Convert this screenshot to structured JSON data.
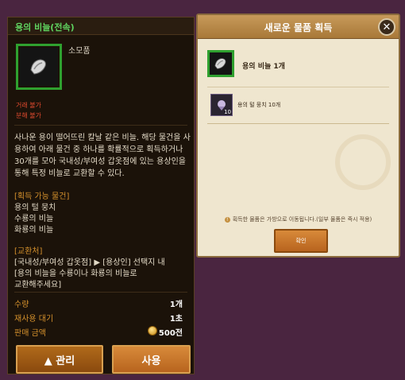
{
  "tooltip": {
    "title": "용의 비늘(전속)",
    "item_type": "소모품",
    "flags": [
      "거래 불가",
      "분해 불가"
    ],
    "description": "사나운 용이 떨어뜨린 칼날 같은 비늘. 해당 물건을 사용하여 아래 물건 중 하나를 확률적으로 획득하거나 30개를 모아 국내성/부여성 갑옷점에 있는 용상인을 통해 특정 비늘로 교환할 수 있다.",
    "obtainable_header": "[획득 가능 물건]",
    "obtainable_items": [
      "용의 털 뭉치",
      "수룡의 비늘",
      "화룡의 비늘"
    ],
    "exchange_header": "[교환처]",
    "exchange_lines": [
      "[국내성/부여성 갑옷점] ▶ [용상인] 선택지 내",
      "[용의 비늘을 수룡이나 화룡의 비늘로",
      "교환해주세요]"
    ],
    "stats": [
      {
        "label": "수량",
        "value": "1개"
      },
      {
        "label": "재사용 대기",
        "value": "1초"
      },
      {
        "label": "판매 금액",
        "value": "500전"
      }
    ],
    "manage_button": "▲ 관리",
    "use_button": "사용"
  },
  "dialog": {
    "title": "새로운 물품 획득",
    "close_icon": "✕",
    "obtained_item": "용의 비늘 1개",
    "sub_item": "용의 털 뭉치 10개",
    "sub_item_count": "10",
    "notice": "획득한 물품은 가방으로 이동됩니다.(일부 물품은 즉시 적용)",
    "confirm_button": "확인"
  },
  "colors": {
    "rare_green": "#2fa02f",
    "section_orange": "#d4902c",
    "warning_red": "#e04a2e"
  }
}
